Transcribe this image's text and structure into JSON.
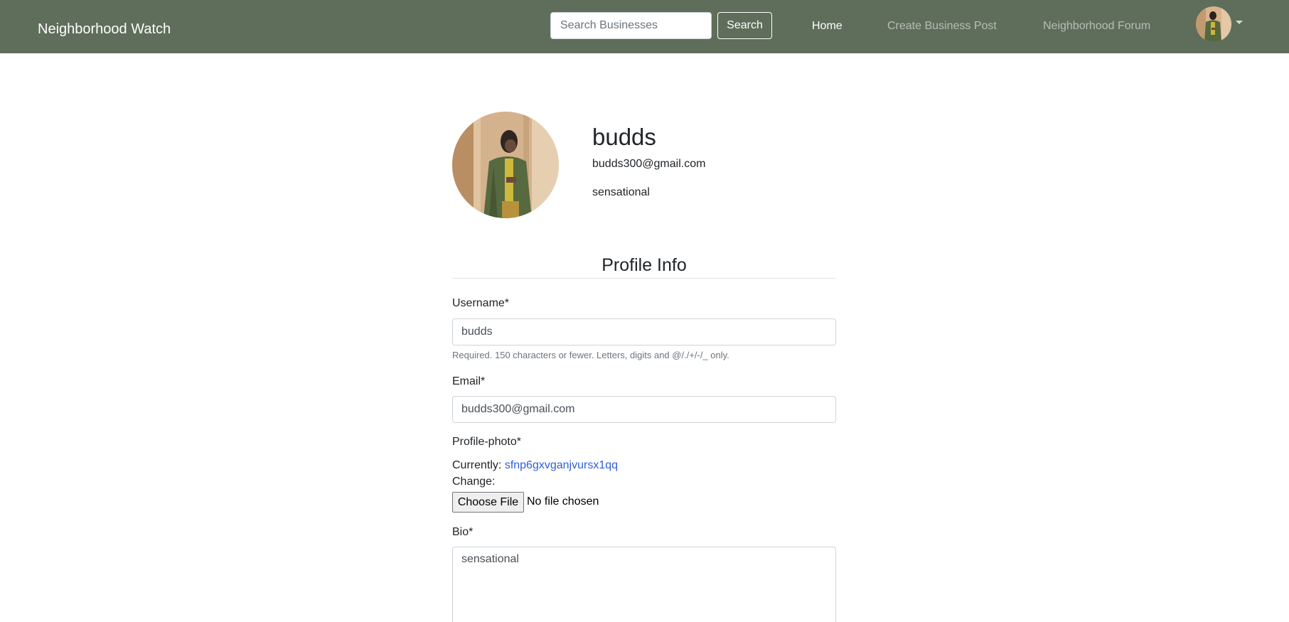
{
  "navbar": {
    "brand": "Neighborhood Watch",
    "search_placeholder": "Search Businesses",
    "search_button": "Search",
    "links": [
      "Home",
      "Create Business Post",
      "Neighborhood Forum"
    ]
  },
  "profile": {
    "username": "budds",
    "email": "budds300@gmail.com",
    "bio": "sensational"
  },
  "form": {
    "title": "Profile Info",
    "username_label": "Username*",
    "username_value": "budds",
    "username_help": "Required. 150 characters or fewer. Letters, digits and @/./+/-/_ only.",
    "email_label": "Email*",
    "email_value": "budds300@gmail.com",
    "photo_label": "Profile-photo*",
    "currently_label": "Currently:",
    "currently_file": "sfnp6gxvganjvursx1qq",
    "change_label": "Change:",
    "choose_file_button": "Choose File",
    "no_file_text": "No file chosen",
    "bio_label": "Bio*",
    "bio_value": "sensational"
  },
  "colors": {
    "navbar_bg": "#5f6d5b",
    "link_blue": "#2f5fdc"
  },
  "icons": {
    "avatar": "user-avatar-photo",
    "dropdown": "caret-down-icon"
  }
}
